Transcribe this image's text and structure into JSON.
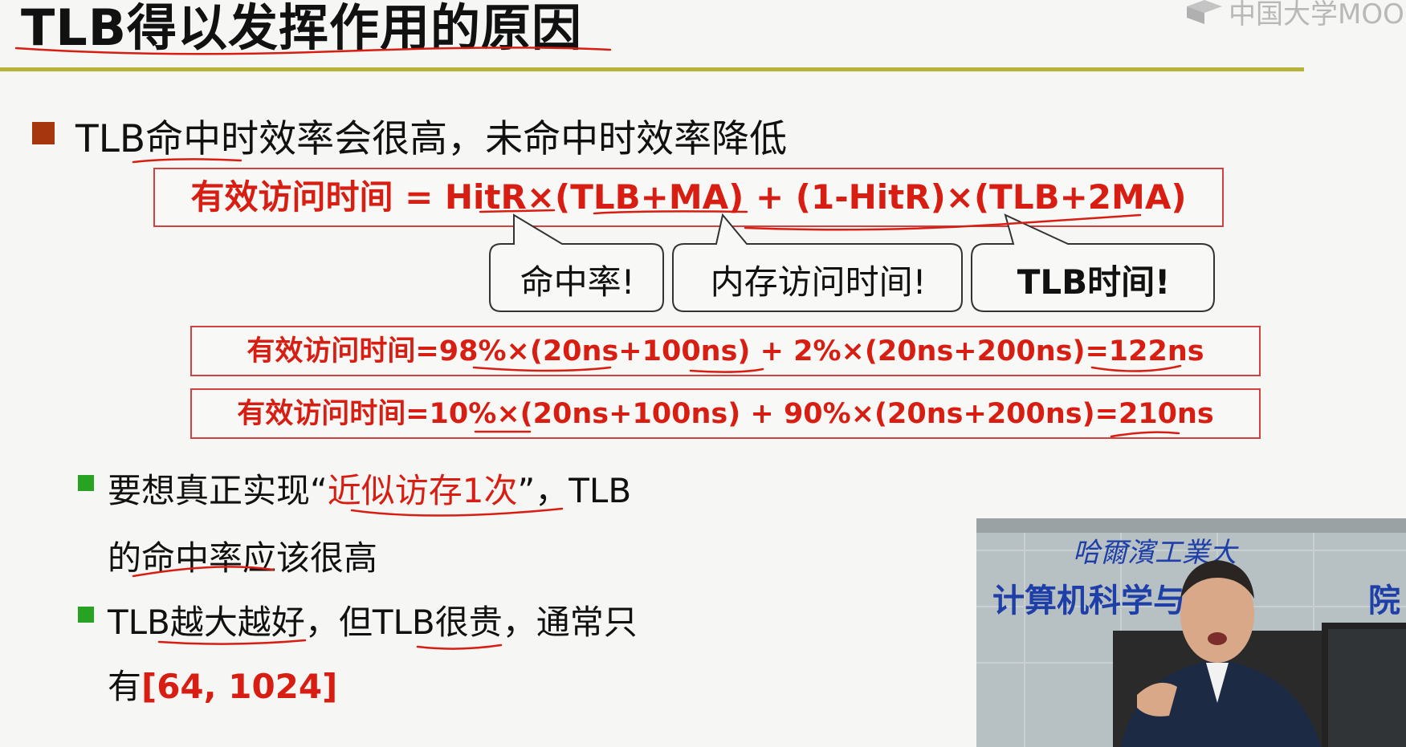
{
  "slide": {
    "title": "TLB得以发挥作用的原因",
    "watermark": "中国大学MOOC",
    "main_bullet": "TLB命中时效率会很高，未命中时效率降低",
    "formula": "有效访问时间 = HitR×(TLB+MA) + (1-HitR)×(TLB+2MA)",
    "callouts": {
      "hit_rate": "命中率!",
      "memory_time": "内存访问时间!",
      "tlb_time": "TLB时间!"
    },
    "examples": [
      "有效访问时间=98%×(20ns+100ns) +  2%×(20ns+200ns)=122ns",
      "有效访问时间=10%×(20ns+100ns) + 90%×(20ns+200ns)=210ns"
    ],
    "sub_bullets": [
      {
        "line1_before": "要想真正实现“",
        "line1_red": "近似访存1次",
        "line1_after": "”，TLB",
        "line2": "的命中率应该很高"
      },
      {
        "line1": "TLB越大越好，但TLB很贵，通常只",
        "line2_before": "有",
        "line2_red": "[64, 1024]"
      }
    ]
  },
  "video": {
    "banner_line1": "哈爾濱工業大",
    "banner_line2": "计算机科学与技",
    "banner_end": "院"
  },
  "colors": {
    "accent_red": "#d81e12",
    "rule_olive": "#b6b23a",
    "bullet_brown": "#a6360e",
    "bullet_green": "#27a321",
    "banner_blue": "#1f3fa8"
  }
}
